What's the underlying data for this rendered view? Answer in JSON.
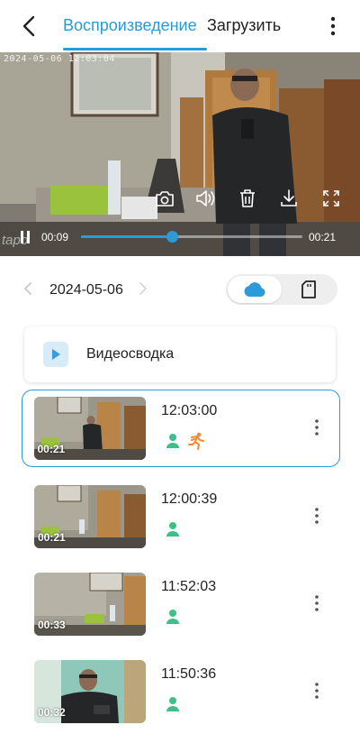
{
  "header": {
    "tabs": [
      {
        "label": "Воспроизведение",
        "active": true
      },
      {
        "label": "Загрузить",
        "active": false
      }
    ]
  },
  "player": {
    "osd_timestamp": "2024-05-06 12:03:04",
    "watermark": "tapo",
    "current_time": "00:09",
    "total_time": "00:21",
    "progress_fraction": 0.41,
    "controls": [
      "camera-icon",
      "speaker-icon",
      "trash-icon",
      "download-icon",
      "fullscreen-icon"
    ]
  },
  "date_bar": {
    "date": "2024-05-06",
    "storage_options": [
      "cloud",
      "sd-card"
    ],
    "selected_storage": "cloud"
  },
  "summary": {
    "label": "Видеосводка"
  },
  "clips": [
    {
      "time": "12:03:00",
      "duration": "00:21",
      "events": [
        "person",
        "motion"
      ],
      "selected": true
    },
    {
      "time": "12:00:39",
      "duration": "00:21",
      "events": [
        "person"
      ],
      "selected": false
    },
    {
      "time": "11:52:03",
      "duration": "00:33",
      "events": [
        "person"
      ],
      "selected": false
    },
    {
      "time": "11:50:36",
      "duration": "00:32",
      "events": [
        "person"
      ],
      "selected": false
    }
  ],
  "colors": {
    "accent": "#2b9ad8",
    "person_event": "#3dbf8a",
    "motion_event": "#f08a3a"
  }
}
